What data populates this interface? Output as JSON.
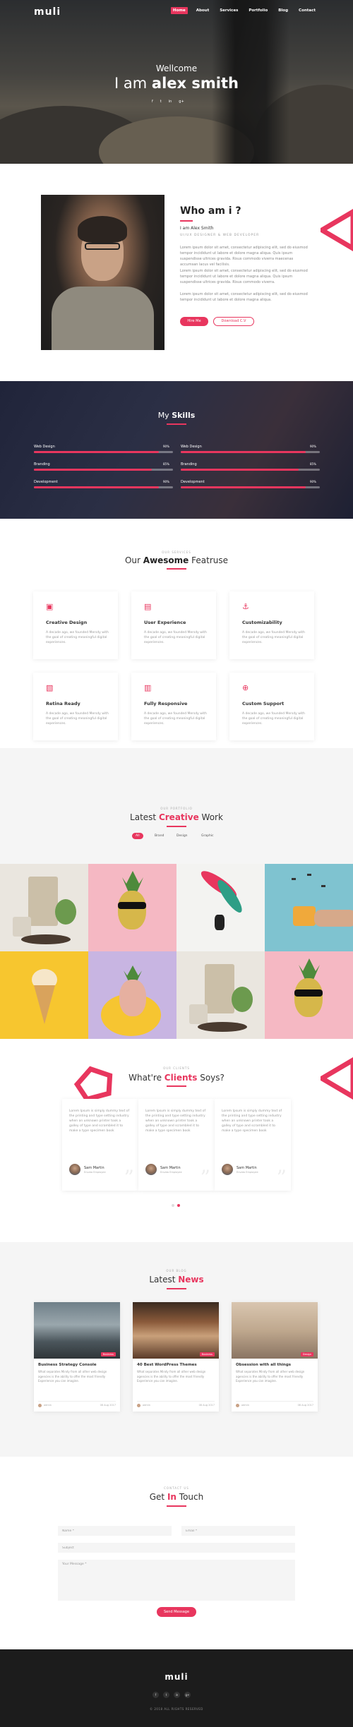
{
  "brand": "muli",
  "nav": [
    "Home",
    "About",
    "Services",
    "Portfolio",
    "Blog",
    "Contact"
  ],
  "hero": {
    "greeting": "Wellcome",
    "headline_prefix": "I am ",
    "headline_name": "alex smith",
    "social": [
      "f",
      "t",
      "in",
      "g+"
    ]
  },
  "about": {
    "title": "Who am i ?",
    "name": "I am Alex Smith",
    "role": "UI/UX DESIGNER & WEB DEVELOPER",
    "paragraphs": [
      "Lorem ipsum dolor sit amet, consectetur adipiscing elit, sed do eiusmod tempor incididunt ut labore et dolore magna aliqua. Quis ipsum suspendisse ultrices gravida. Risus commodo viverra maecenas accumsan lacus vel facilisis.",
      "Lorem ipsum dolor sit amet, consectetur adipiscing elit, sed do eiusmod tempor incididunt ut labore et dolore magna aliqua. Quis ipsum suspendisse ultrices gravida. Risus commodo viverra.",
      "Lorem ipsum dolor sit amet, consectetur adipiscing elit, sed do eiusmod tempor incididunt ut labore et dolore magna aliqua."
    ],
    "hire_label": "Hire Me",
    "download_label": "Download C.V"
  },
  "skills": {
    "heading_prefix": "My ",
    "heading_bold": "Skills",
    "items": [
      {
        "label": "Web Design",
        "pct": "90%",
        "value": 0.9
      },
      {
        "label": "Web Design",
        "pct": "90%",
        "value": 0.9
      },
      {
        "label": "Branding",
        "pct": "85%",
        "value": 0.85
      },
      {
        "label": "Branding",
        "pct": "85%",
        "value": 0.85
      },
      {
        "label": "Development",
        "pct": "90%",
        "value": 0.9
      },
      {
        "label": "Development",
        "pct": "90%",
        "value": 0.9
      }
    ]
  },
  "services": {
    "small": "OUR SERVICES",
    "title_prefix": "Our ",
    "title_bold": "Awesome",
    "title_suffix": " Featruse",
    "items": [
      {
        "icon": "▣",
        "title": "Creative Design",
        "desc": "A decade ago, we founded Mersdy with the goal of creating meaningful digital experiences."
      },
      {
        "icon": "▤",
        "title": "User Experience",
        "desc": "A decade ago, we founded Mersdy with the goal of creating meaningful digital experiences."
      },
      {
        "icon": "⚓",
        "title": "Customizability",
        "desc": "A decade ago, we founded Mersdy with the goal of creating meaningful digital experiences."
      },
      {
        "icon": "▧",
        "title": "Retina Ready",
        "desc": "A decade ago, we founded Mersdy with the goal of creating meaningful digital experiences."
      },
      {
        "icon": "▥",
        "title": "Fully Responsive",
        "desc": "A decade ago, we founded Mersdy with the goal of creating meaningful digital experiences."
      },
      {
        "icon": "⊕",
        "title": "Custom Support",
        "desc": "A decade ago, we founded Mersdy with the goal of creating meaningful digital experiences."
      }
    ]
  },
  "portfolio": {
    "small": "OUR PORTFOLIO",
    "title_prefix": "Latest ",
    "title_bold": "Creative",
    "title_suffix": " Work",
    "filters": [
      "All",
      "Brand",
      "Design",
      "Graphic"
    ]
  },
  "testimonials": {
    "small": "OUR CLIENTS",
    "title_prefix": "What're ",
    "title_bold": "Clients",
    "title_suffix": " Soys?",
    "items": [
      {
        "text": "Lorem Ipsum is simply dummy text of the printing and type setting industry when an unknown printer took a galley of type and scrambled it to make a type specimen book",
        "name": "Sam Martin",
        "role": "Envato Employee"
      },
      {
        "text": "Lorem Ipsum is simply dummy text of the printing and type setting industry when an unknown printer took a galley of type and scrambled it to make a type specimen book",
        "name": "Sam Martin",
        "role": "Envato Employee"
      },
      {
        "text": "Lorem Ipsum is simply dummy text of the printing and type setting industry when an unknown printer took a galley of type and scrambled it to make a type specimen book",
        "name": "Sam Martin",
        "role": "Envato Employee"
      }
    ]
  },
  "news": {
    "small": "OUR BLOG",
    "title_prefix": "Latest ",
    "title_bold": "News",
    "items": [
      {
        "tag": "Business",
        "title": "Business Strategy Console",
        "desc": "What separates Mindy from all other web design agencies is the ability to offer the most friendly Experience you can imagine.",
        "author": "admin",
        "date": "08 Aug 2017"
      },
      {
        "tag": "Business",
        "title": "40 Best WordPress Themes",
        "desc": "What separates Mindy from all other web design agencies is the ability to offer the most friendly Experience you can imagine.",
        "author": "admin",
        "date": "08 Aug 2017"
      },
      {
        "tag": "Design",
        "title": "Obsession with all things",
        "desc": "What separates Mindy from all other web design agencies is the ability to offer the most friendly Experience you can imagine.",
        "author": "admin",
        "date": "08 Aug 2017"
      }
    ]
  },
  "contact": {
    "small": "CONTACT US",
    "title_prefix": "Get ",
    "title_bold": "In",
    "title_suffix": " Touch",
    "name_placeholder": "Name *",
    "email_placeholder": "Email *",
    "subject_placeholder": "Subject",
    "message_placeholder": "Your Message *",
    "send_label": "Send Message"
  },
  "footer": {
    "brand": "muli",
    "social": [
      "f",
      "t",
      "in",
      "g+"
    ],
    "copyright": "© 2018 ALL RIGHTS RESERVED"
  },
  "colors": {
    "accent": "#e8365e",
    "dark": "#1c1c1c",
    "light_bg": "#f5f5f5"
  }
}
